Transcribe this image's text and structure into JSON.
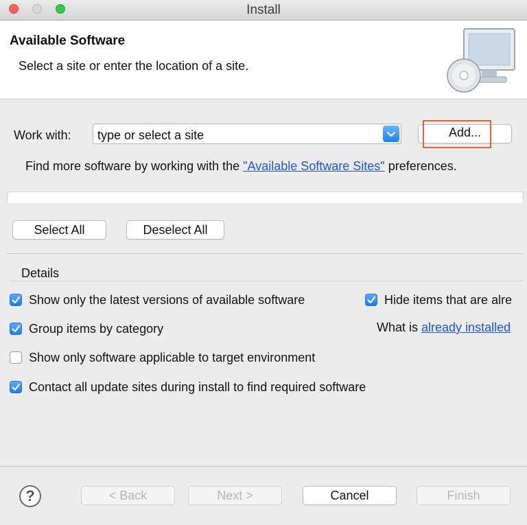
{
  "window": {
    "title": "Install"
  },
  "banner": {
    "title": "Available Software",
    "description": "Select a site or enter the location of a site."
  },
  "work_with": {
    "label": "Work with:",
    "placeholder": "type or select a site",
    "add_label": "Add...",
    "hint_prefix": "Find more software by working with the ",
    "hint_link": "\"Available Software Sites\"",
    "hint_suffix": " preferences."
  },
  "selection": {
    "select_all": "Select All",
    "deselect_all": "Deselect All"
  },
  "details": {
    "label": "Details",
    "options": [
      {
        "label": "Show only the latest versions of available software",
        "checked": true
      },
      {
        "label": "Group items by category",
        "checked": true
      },
      {
        "label": "Show only software applicable to target environment",
        "checked": false
      },
      {
        "label": "Contact all update sites during install to find required software",
        "checked": true
      }
    ],
    "hide_installed": {
      "label": "Hide items that are alre",
      "checked": true
    },
    "installed_prefix": "What is ",
    "installed_link": "already installed"
  },
  "footer": {
    "help": "?",
    "back": "< Back",
    "next": "Next >",
    "cancel": "Cancel",
    "finish": "Finish"
  },
  "colors": {
    "accent": "#1a7ef5",
    "focus": "#e0662b",
    "link": "#1c55e0"
  }
}
